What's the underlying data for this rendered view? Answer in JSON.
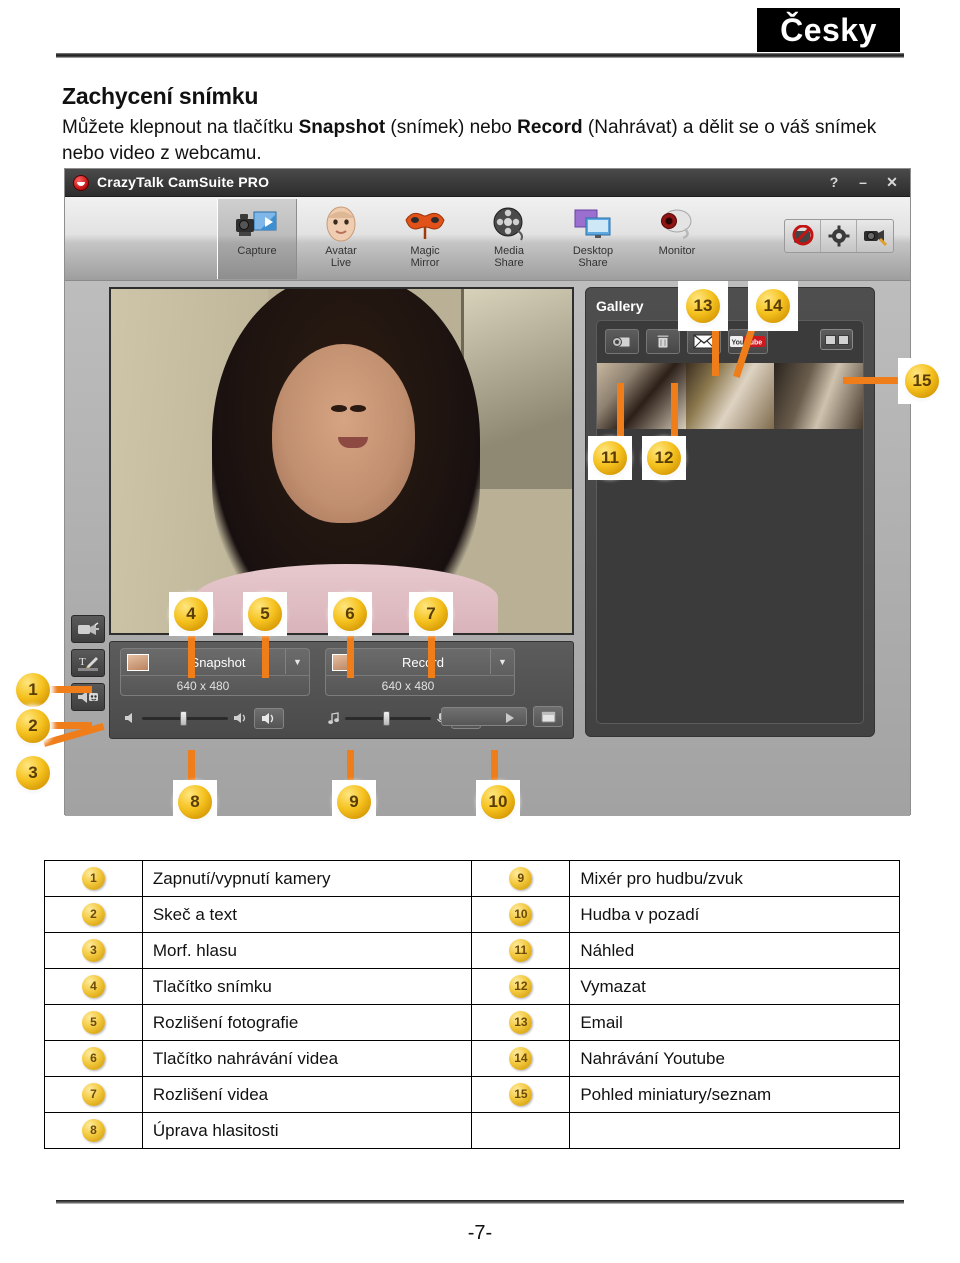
{
  "page": {
    "language_badge": "Česky",
    "title": "Zachycení snímku",
    "body_pre": "Můžete klepnout na tlačítku ",
    "body_bold1": "Snapshot",
    "body_mid": " (snímek) nebo ",
    "body_bold2": "Record",
    "body_post": " (Nahrávat) a dělit se o váš snímek nebo video z webcamu.",
    "page_number": "-7-"
  },
  "app": {
    "title": "CrazyTalk CamSuite PRO",
    "window_buttons": [
      {
        "name": "help",
        "glyph": "?"
      },
      {
        "name": "minimize",
        "glyph": "–"
      },
      {
        "name": "close",
        "glyph": "✕"
      }
    ],
    "toolbar": [
      {
        "label_line1": "Capture",
        "label_line2": "",
        "icon": "camcorder-icon",
        "active": true
      },
      {
        "label_line1": "Avatar",
        "label_line2": "Live",
        "icon": "face-icon",
        "active": false
      },
      {
        "label_line1": "Magic",
        "label_line2": "Mirror",
        "icon": "mask-icon",
        "active": false
      },
      {
        "label_line1": "Media",
        "label_line2": "Share",
        "icon": "film-reel-icon",
        "active": false
      },
      {
        "label_line1": "Desktop",
        "label_line2": "Share",
        "icon": "monitor-share-icon",
        "active": false
      },
      {
        "label_line1": "Monitor",
        "label_line2": "",
        "icon": "webcam-icon",
        "active": false
      }
    ],
    "right_tools": [
      {
        "name": "emoticon-off-icon"
      },
      {
        "name": "gear-icon"
      },
      {
        "name": "camera-setup-icon"
      }
    ],
    "rail_buttons": [
      {
        "name": "camera-toggle-icon"
      },
      {
        "name": "sketch-text-icon"
      },
      {
        "name": "voice-morph-icon"
      }
    ],
    "snapshot": {
      "label": "Snapshot",
      "resolution": "640 x 480"
    },
    "record": {
      "label": "Record",
      "resolution": "640 x 480"
    },
    "gallery": {
      "title": "Gallery",
      "tools": [
        {
          "name": "preview-icon"
        },
        {
          "name": "trash-icon"
        },
        {
          "name": "email-icon"
        },
        {
          "name": "youtube-icon",
          "label_you": "You",
          "label_tube": "Tube"
        }
      ],
      "view_toggle": "thumbnail-list-toggle-icon",
      "thumbnails": [
        "photo-1",
        "photo-2",
        "photo-3"
      ]
    }
  },
  "callouts": [
    {
      "n": "1"
    },
    {
      "n": "2"
    },
    {
      "n": "3"
    },
    {
      "n": "4"
    },
    {
      "n": "5"
    },
    {
      "n": "6"
    },
    {
      "n": "7"
    },
    {
      "n": "8"
    },
    {
      "n": "9"
    },
    {
      "n": "10"
    },
    {
      "n": "11"
    },
    {
      "n": "12"
    },
    {
      "n": "13"
    },
    {
      "n": "14"
    },
    {
      "n": "15"
    }
  ],
  "legend": {
    "rows": [
      {
        "n1": "1",
        "t1": "Zapnutí/vypnutí kamery",
        "n2": "9",
        "t2": "Mixér pro hudbu/zvuk"
      },
      {
        "n1": "2",
        "t1": "Skeč a text",
        "n2": "10",
        "t2": "Hudba v pozadí"
      },
      {
        "n1": "3",
        "t1": "Morf. hlasu",
        "n2": "11",
        "t2": "Náhled"
      },
      {
        "n1": "4",
        "t1": "Tlačítko snímku",
        "n2": "12",
        "t2": "Vymazat"
      },
      {
        "n1": "5",
        "t1": "Rozlišení fotografie",
        "n2": "13",
        "t2": "Email"
      },
      {
        "n1": "6",
        "t1": "Tlačítko nahrávání videa",
        "n2": "14",
        "t2": "Nahrávání Youtube"
      },
      {
        "n1": "7",
        "t1": "Rozlišení videa",
        "n2": "15",
        "t2": "Pohled miniatury/seznam"
      },
      {
        "n1": "8",
        "t1": "Úprava hlasitosti",
        "n2": "",
        "t2": ""
      }
    ]
  },
  "colors": {
    "callout": "#f5c21f",
    "leader": "#ef7d1a",
    "titlebar": "#3b3b3b",
    "youtube_red": "#cc181e"
  }
}
